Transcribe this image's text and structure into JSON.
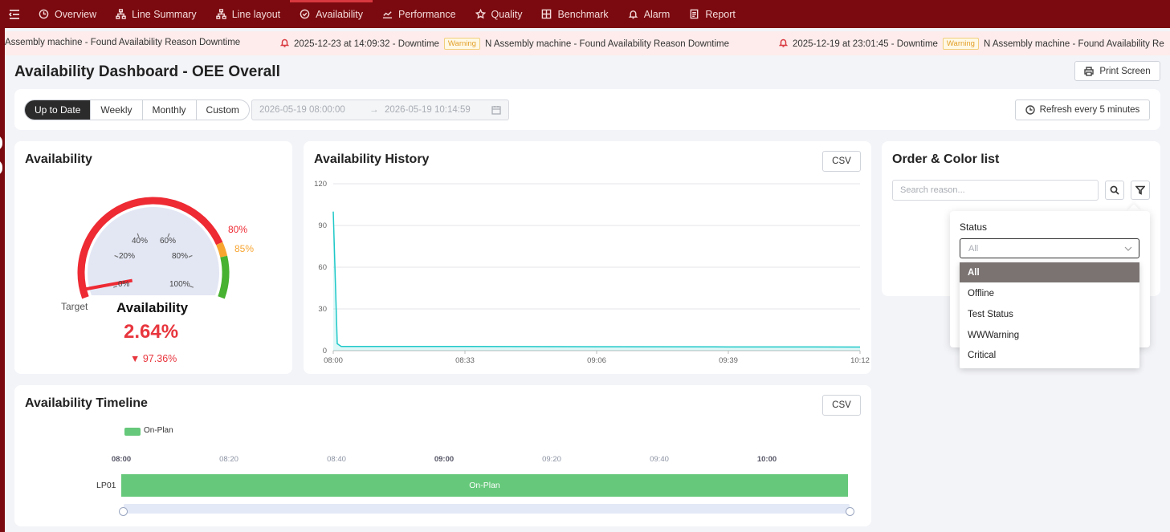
{
  "nav": {
    "items": [
      {
        "label": "Overview",
        "icon": "clock-icon"
      },
      {
        "label": "Line Summary",
        "icon": "sitemap-icon"
      },
      {
        "label": "Line layout",
        "icon": "sitemap-icon"
      },
      {
        "label": "Availability",
        "icon": "check-circle-icon",
        "active": true
      },
      {
        "label": "Performance",
        "icon": "line-chart-icon"
      },
      {
        "label": "Quality",
        "icon": "star-icon"
      },
      {
        "label": "Benchmark",
        "icon": "grid-icon"
      },
      {
        "label": "Alarm",
        "icon": "bell-icon"
      },
      {
        "label": "Report",
        "icon": "report-icon"
      }
    ]
  },
  "ticker": {
    "seg1_message": "Assembly machine - Found Availability Reason Downtime",
    "seg2_time": "2025-12-23 at 14:09:32 - Downtime",
    "seg2_badge": "Warning",
    "seg2_message": "N Assembly machine - Found Availability Reason Downtime",
    "seg3_time": "2025-12-19 at 23:01:45 - Downtime",
    "seg3_badge": "Warning",
    "seg3_message": "N Assembly machine - Found Availability Re"
  },
  "page": {
    "title": "Availability Dashboard - OEE Overall",
    "print_label": "Print Screen"
  },
  "filter": {
    "range_options": [
      "Up to Date",
      "Weekly",
      "Monthly",
      "Custom"
    ],
    "selected_range": "Up to Date",
    "start": "2026-05-19 08:00:00",
    "end": "2026-05-19 10:14:59",
    "refresh_label": "Refresh every 5 minutes"
  },
  "availability_card": {
    "title": "Availability",
    "gauge_ticks": [
      "0%",
      "20%",
      "40%",
      "60%",
      "80%",
      "100%"
    ],
    "threshold_red": "80%",
    "threshold_orange": "85%",
    "target_label": "Target",
    "metric_label": "Availability",
    "value_text": "2.64%",
    "value": 2.64,
    "delta_text": "97.36%",
    "colors": {
      "red": "#ee2a33",
      "orange": "#f7a531",
      "green": "#47b131",
      "fill": "#e3e7f4"
    }
  },
  "history_card": {
    "title": "Availability History",
    "csv_label": "CSV"
  },
  "order_card": {
    "title": "Order & Color list",
    "search_placeholder": "Search reason...",
    "status_label": "Status",
    "status_placeholder": "All",
    "status_options": [
      "All",
      "Offline",
      "Test Status",
      "WWWarning",
      "Critical"
    ],
    "selected_option": "All"
  },
  "timeline_card": {
    "title": "Availability Timeline",
    "csv_label": "CSV",
    "legend": "On-Plan",
    "legend_color": "#66c87a",
    "time_ticks": [
      "08:00",
      "08:20",
      "08:40",
      "09:00",
      "09:20",
      "09:40",
      "10:00"
    ],
    "bold_ticks": [
      "08:00",
      "09:00",
      "10:00"
    ],
    "row_label": "LP01",
    "bar_label": "On-Plan"
  },
  "chart_data": {
    "type": "line",
    "title": "Availability History",
    "xlabel": "",
    "ylabel": "",
    "x_ticks": [
      "08:00",
      "08:33",
      "09:06",
      "09:39",
      "10:12"
    ],
    "y_ticks": [
      0,
      30,
      60,
      90,
      120
    ],
    "ylim": [
      0,
      120
    ],
    "grid": true,
    "series": [
      {
        "color": "#1fc8c8",
        "x": [
          "08:00",
          "08:01",
          "08:02",
          "08:33",
          "09:06",
          "09:39",
          "10:12"
        ],
        "y": [
          100,
          5,
          3,
          3,
          2.8,
          2.7,
          2.6
        ]
      }
    ]
  }
}
